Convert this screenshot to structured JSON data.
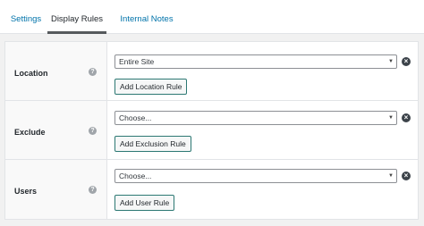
{
  "tabs": [
    {
      "label": "Settings",
      "active": false
    },
    {
      "label": "Display Rules",
      "active": true
    },
    {
      "label": "Internal Notes",
      "active": false
    }
  ],
  "rules": [
    {
      "label": "Location",
      "select_value": "Entire Site",
      "button_label": "Add Location Rule"
    },
    {
      "label": "Exclude",
      "select_value": "Choose...",
      "button_label": "Add Exclusion Rule"
    },
    {
      "label": "Users",
      "select_value": "Choose...",
      "button_label": "Add User Rule"
    }
  ],
  "icons": {
    "help": "help-icon",
    "remove": "remove-icon",
    "dropdown": "chevron-down-icon"
  },
  "colors": {
    "link": "#0073aa",
    "active_tab_border": "#55595c",
    "button_border": "#2c7873"
  }
}
